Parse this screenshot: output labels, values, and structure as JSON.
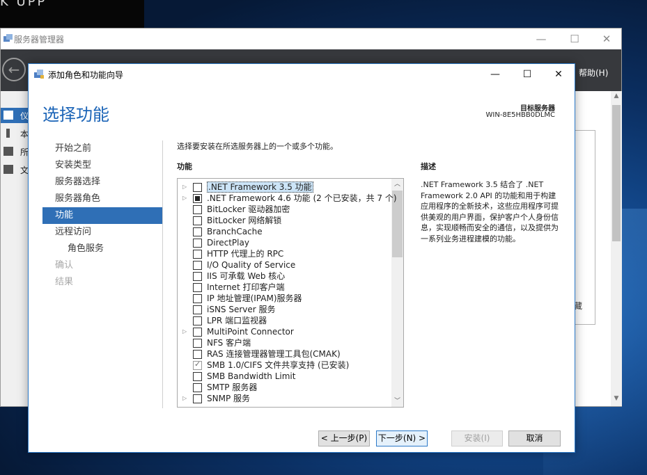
{
  "desktop": {
    "top_fragment": "K UPP"
  },
  "server_manager": {
    "title": "服务器管理器",
    "help_label": "帮助(H)",
    "sidebar_items": [
      "仪",
      "本",
      "所",
      "文"
    ],
    "right_pane_char": "藏",
    "controls": {
      "minimize": "—",
      "maximize": "☐",
      "close": "✕"
    }
  },
  "wizard": {
    "title": "添加角色和功能向导",
    "controls": {
      "minimize": "—",
      "maximize": "☐",
      "close": "✕"
    },
    "heading": "选择功能",
    "target_label": "目标服务器",
    "target_server": "WIN-8E5HBB0DLMC",
    "nav": [
      {
        "label": "开始之前",
        "state": "normal"
      },
      {
        "label": "安装类型",
        "state": "normal"
      },
      {
        "label": "服务器选择",
        "state": "normal"
      },
      {
        "label": "服务器角色",
        "state": "normal"
      },
      {
        "label": "功能",
        "state": "active"
      },
      {
        "label": "远程访问",
        "state": "normal"
      },
      {
        "label": "角色服务",
        "state": "sub"
      },
      {
        "label": "确认",
        "state": "disabled"
      },
      {
        "label": "结果",
        "state": "disabled"
      }
    ],
    "instruction": "选择要安装在所选服务器上的一个或多个功能。",
    "features_label": "功能",
    "features": [
      {
        "label": ".NET Framework 3.5 功能",
        "expandable": true,
        "state": "unchecked",
        "selected": true
      },
      {
        "label": ".NET Framework 4.6 功能 (2 个已安装，共 7 个)",
        "expandable": true,
        "state": "partial",
        "selected": false
      },
      {
        "label": "BitLocker 驱动器加密",
        "expandable": false,
        "state": "unchecked",
        "selected": false
      },
      {
        "label": "BitLocker 网络解锁",
        "expandable": false,
        "state": "unchecked",
        "selected": false
      },
      {
        "label": "BranchCache",
        "expandable": false,
        "state": "unchecked",
        "selected": false
      },
      {
        "label": "DirectPlay",
        "expandable": false,
        "state": "unchecked",
        "selected": false
      },
      {
        "label": "HTTP 代理上的 RPC",
        "expandable": false,
        "state": "unchecked",
        "selected": false
      },
      {
        "label": "I/O Quality of Service",
        "expandable": false,
        "state": "unchecked",
        "selected": false
      },
      {
        "label": "IIS 可承载 Web 核心",
        "expandable": false,
        "state": "unchecked",
        "selected": false
      },
      {
        "label": "Internet 打印客户端",
        "expandable": false,
        "state": "unchecked",
        "selected": false
      },
      {
        "label": "IP 地址管理(IPAM)服务器",
        "expandable": false,
        "state": "unchecked",
        "selected": false
      },
      {
        "label": "iSNS Server 服务",
        "expandable": false,
        "state": "unchecked",
        "selected": false
      },
      {
        "label": "LPR 端口监视器",
        "expandable": false,
        "state": "unchecked",
        "selected": false
      },
      {
        "label": "MultiPoint Connector",
        "expandable": true,
        "state": "unchecked",
        "selected": false
      },
      {
        "label": "NFS 客户端",
        "expandable": false,
        "state": "unchecked",
        "selected": false
      },
      {
        "label": "RAS 连接管理器管理工具包(CMAK)",
        "expandable": false,
        "state": "unchecked",
        "selected": false
      },
      {
        "label": "SMB 1.0/CIFS 文件共享支持 (已安装)",
        "expandable": false,
        "state": "checked",
        "selected": false
      },
      {
        "label": "SMB Bandwidth Limit",
        "expandable": false,
        "state": "unchecked",
        "selected": false
      },
      {
        "label": "SMTP 服务器",
        "expandable": false,
        "state": "unchecked",
        "selected": false
      },
      {
        "label": "SNMP 服务",
        "expandable": true,
        "state": "unchecked",
        "selected": false
      }
    ],
    "description_label": "描述",
    "description": ".NET Framework 3.5 结合了 .NET Framework 2.0 API 的功能和用于构建应用程序的全新技术，这些应用程序可提供美观的用户界面，保护客户个人身份信息，实现顺畅而安全的通信，以及提供为一系列业务进程建模的功能。",
    "buttons": {
      "previous": "< 上一步(P)",
      "next": "下一步(N) >",
      "install": "安装(I)",
      "cancel": "取消"
    }
  }
}
